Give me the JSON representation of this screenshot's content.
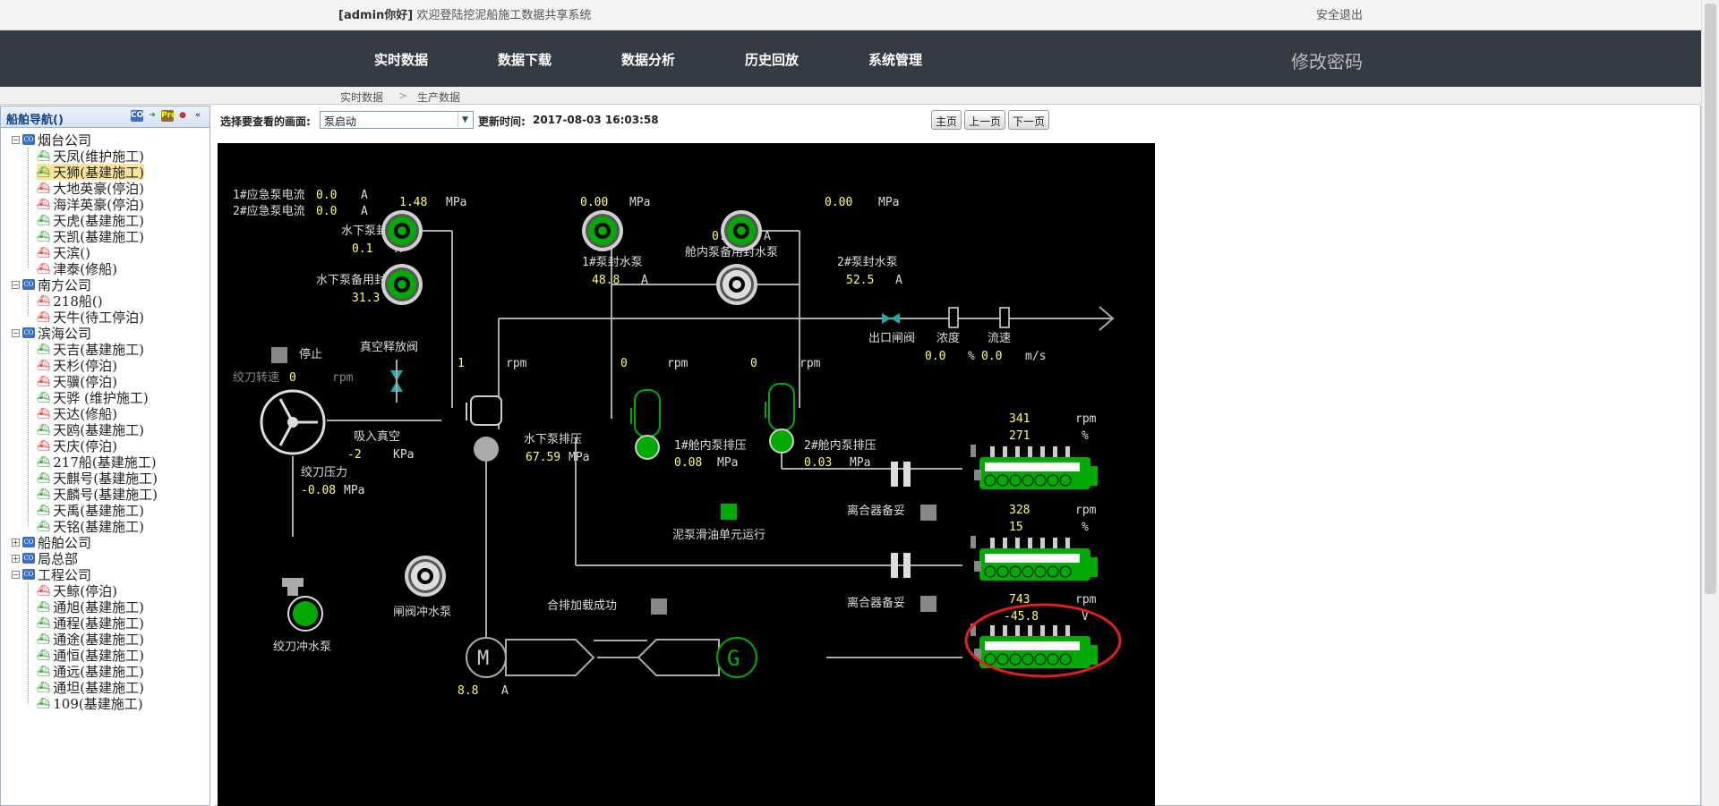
{
  "header": {
    "user": "[admin你好]",
    "welcome": "欢迎登陆挖泥船施工数据共享系统",
    "logout": "安全退出"
  },
  "nav": {
    "items": [
      "实时数据",
      "数据下载",
      "数据分析",
      "历史回放",
      "系统管理"
    ],
    "change_password": "修改密码"
  },
  "breadcrumb": {
    "root": "实时数据",
    "sep": ">",
    "current": "生产数据"
  },
  "sidebar": {
    "title": "船舶导航()",
    "groups": [
      {
        "name": "烟台公司",
        "ships": [
          "天凤(维护施工)",
          "天狮(基建施工)",
          "大地英豪(停泊)",
          "海洋英豪(停泊)",
          "天虎(基建施工)",
          "天凯(基建施工)",
          "天滨()",
          "津泰(修船)"
        ]
      },
      {
        "name": "南方公司",
        "ships": [
          "218船()",
          "天牛(待工停泊)"
        ]
      },
      {
        "name": "滨海公司",
        "ships": [
          "天吉(基建施工)",
          "天杉(停泊)",
          "天骥(停泊)",
          "天骅 (维护施工)",
          "天达(修船)",
          "天鸥(基建施工)",
          "天庆(停泊)",
          "217船(基建施工)",
          "天麒号(基建施工)",
          "天麟号(基建施工)",
          "天禹(基建施工)",
          "天铭(基建施工)"
        ]
      },
      {
        "name": "船舶公司",
        "ships": []
      },
      {
        "name": "局总部",
        "ships": []
      },
      {
        "name": "工程公司",
        "ships": [
          "天鲸(停泊)",
          "通旭(基建施工)",
          "通程(基建施工)",
          "通途(基建施工)",
          "通恒(基建施工)",
          "通远(基建施工)",
          "通坦(基建施工)",
          "109(基建施工)"
        ]
      }
    ],
    "selected": "天狮(基建施工)"
  },
  "controls": {
    "select_label": "选择要查看的画面:",
    "select_value": "泵启动",
    "update_label": "更新时间:",
    "update_time": "2017-08-03 16:03:58",
    "btn_home": "主页",
    "btn_prev": "上一页",
    "btn_next": "下一页"
  },
  "scada": {
    "em1_label": "1#应急泵电流",
    "em1_val": "0.0",
    "em1_unit": "A",
    "em2_label": "2#应急泵电流",
    "em2_val": "0.0",
    "em2_unit": "A",
    "uw_seal_label": "水下泵封水泵",
    "uw_seal_p": "1.48",
    "uw_seal_p_unit": "MPa",
    "uw_seal_i": "0.1",
    "uw_seal_i_unit": "A",
    "uw_bak_label": "水下泵备用封水泵",
    "uw_bak_i": "31.3",
    "uw_bak_unit": "A",
    "p1_seal_p": "0.00",
    "p1_seal_p_unit": "MPa",
    "p1_seal_label": "1#泵封水泵",
    "p1_seal_i": "48.8",
    "p1_seal_unit": "A",
    "inb_bak_i": "0.4",
    "inb_bak_unit": "A",
    "inb_bak_label": "舱内泵备用封水泵",
    "p2_seal_p": "0.00",
    "p2_seal_p_unit": "MPa",
    "p2_seal_label": "2#泵封水泵",
    "p2_seal_i": "52.5",
    "p2_seal_unit": "A",
    "outlet_label": "出口闸阀",
    "density_label": "浓度",
    "speed_label": "流速",
    "density_val": "0.0",
    "density_unit": "%",
    "speed_val": "0.0",
    "speed_unit": "m/s",
    "stop_label": "停止",
    "vac_valve_label": "真空释放阀",
    "cutter_speed_label": "绞刀转速",
    "cutter_speed_val": "0",
    "cutter_speed_unit": "rpm",
    "uw_rpm": "1",
    "p1_rpm": "0",
    "p2_rpm": "0",
    "rpm_unit": "rpm",
    "suction_label": "吸入真空",
    "suction_val": "-2",
    "suction_unit": "KPa",
    "uw_dis_label": "水下泵排压",
    "uw_dis_val": "67.59",
    "uw_dis_unit": "MPa",
    "ib1_label": "1#舱内泵排压",
    "ib1_val": "0.08",
    "ib1_unit": "MPa",
    "ib2_label": "2#舱内泵排压",
    "ib2_val": "0.03",
    "ib2_unit": "MPa",
    "cutter_p_label": "绞刀压力",
    "cutter_p_val": "-0.08",
    "cutter_p_unit": "MPa",
    "lube_label": "泥泵滑油单元运行",
    "eng1_rpm": "341",
    "eng1_pct": "271",
    "eng2_rpm": "328",
    "eng2_pct": "15",
    "eng3_rpm": "743",
    "eng3_v": "-45.8",
    "eng_rpm_unit": "rpm",
    "eng_pct_unit": "%",
    "eng_v_unit": "V",
    "clutch1_label": "离合器备妥",
    "clutch2_label": "离合器备妥",
    "gate_flush_label": "闸阀冲水泵",
    "cutter_flush_label": "绞刀冲水泵",
    "parallel_label": "合排加载成功",
    "motor_i": "8.8",
    "motor_unit": "A",
    "motor_symbol": "M",
    "gen_symbol": "G"
  },
  "colors": {
    "green": "#00a000",
    "yellow": "#ffff66",
    "panel": "#000000",
    "nav": "#333b44",
    "highlight": "#fbe59b",
    "annotation": "#e02020"
  }
}
